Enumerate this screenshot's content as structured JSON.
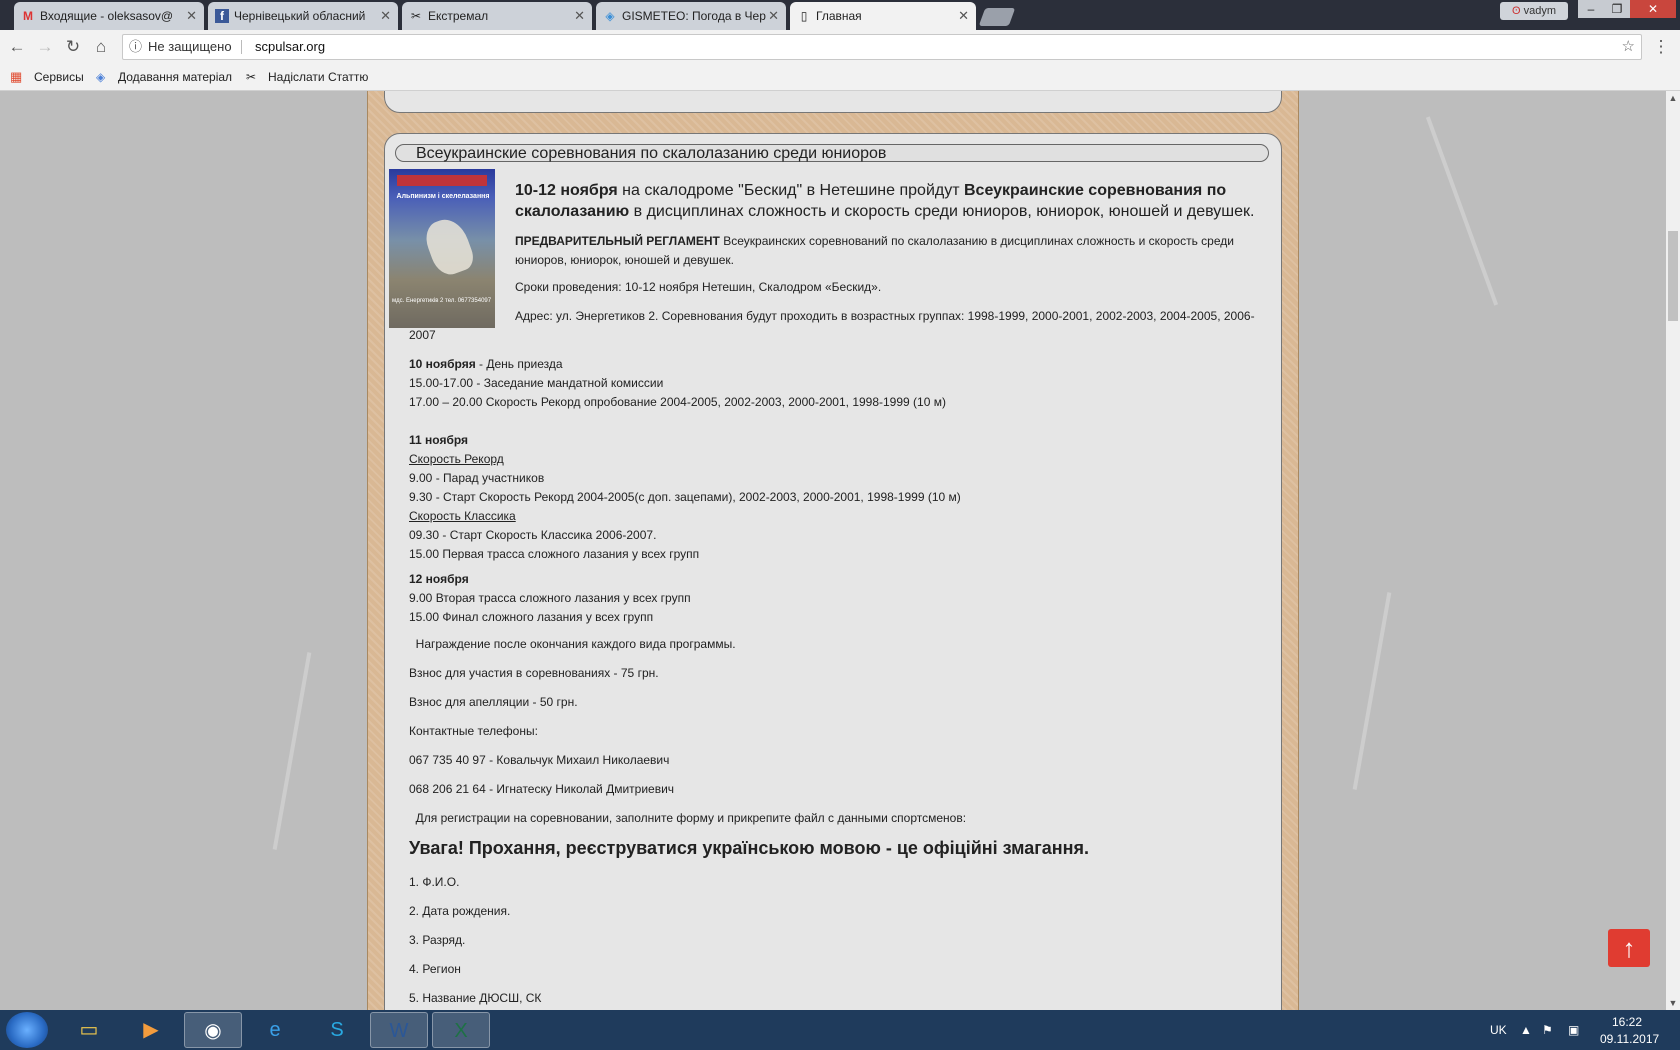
{
  "browser": {
    "tabs": [
      {
        "label": "Входящие - oleksasov@",
        "icon": "M"
      },
      {
        "label": "Чернівецький обласний",
        "icon": "f"
      },
      {
        "label": "Екстремал",
        "icon": "✂"
      },
      {
        "label": "GISMETEO: Погода в Чер",
        "icon": "◈"
      },
      {
        "label": "Главная",
        "icon": "▯"
      }
    ],
    "user": "vadym",
    "security": "Не защищено",
    "url": "scpulsar.org",
    "bookmarks": [
      "Сервисы",
      "Додавання матеріал",
      "Надіслати Статтю"
    ]
  },
  "article": {
    "title": "Всеукраинские соревнования по скалолазанию среди юниоров",
    "poster": {
      "caption": "Альпинизм і скелелазання",
      "info": "мдс. Енергетиків 2 тел. 0677354097"
    },
    "lead": {
      "date": "10-12 ноября",
      "mid": " на скалодроме \"Бескид\" в Нетешине пройдут ",
      "bold": "Всеукраинские соревнования по скалолазанию",
      "tail": "  в дисциплинах сложность и скорость среди юниоров, юниорок, юношей и девушек."
    },
    "reglament_bold": " ПРЕДВАРИТЕЛЬНЫЙ РЕГЛАМЕНТ",
    "reglament_text": " Всеукраинских соревнований по скалолазанию в дисциплинах сложность и скорость среди",
    "reglament_text2": "юниоров, юниорок, юношей и девушек.",
    "terms": "Сроки проведения: 10-12 ноября Нетешин, Скалодром «Бескид».",
    "address": "Адрес: ул. Энергетиков 2. Соревнования будут проходить в возрастных группах: 1998-1999, 2000-2001, 2002-2003, 2004-2005, 2006-",
    "address2": "2007",
    "day10_head": "10 ноябряя",
    "day10_tail": " - День приезда",
    "day10_lines": [
      "15.00-17.00 - Заседание мандатной комиссии",
      "17.00 – 20.00 Скорость Рекорд опробование 2004-2005, 2002-2003, 2000-2001, 1998-1999 (10 м)"
    ],
    "day11_head": "11 ноября",
    "speed_record_link": "Скорость Рекорд",
    "day11_lines_a": [
      "9.00 - Парад участников",
      "9.30 - Старт Скорость Рекорд 2004-2005(с доп. зацепами), 2002-2003, 2000-2001, 1998-1999 (10 м)"
    ],
    "speed_classic_link": "Скорость Классика",
    "day11_lines_b": [
      "09.30 - Старт Скорость Классика 2006-2007.",
      "15.00  Первая трасса сложного лазания у всех групп"
    ],
    "day12_head": "12 ноября",
    "day12_lines": [
      "9.00  Вторая трасса сложного лазания у всех групп",
      "15.00 Финал сложного лазания у всех групп"
    ],
    "award": "  Награждение после окончания каждого вида программы.",
    "fee": "Взнос для участия в соревнованиях - 75 грн.",
    "appeal_fee": "Взнос для апелляции - 50 грн.",
    "contacts_label": "Контактные телефоны:",
    "contact1": "067 735 40 97 - Ковальчук Михаил Николаевич",
    "contact2": "068 206 21 64 - Игнатеску Николай Дмитриевич",
    "registration": "  Для регистрации на соревновании, заполните форму и прикрепите файл с данными спортсменов:",
    "warning": "Увага! Прохання, реєструватися українською мовою - це офіційні змагання.",
    "form_items": [
      "1. Ф.И.О.",
      "2. Дата рождения.",
      "3. Разряд.",
      "4. Регион",
      "5. Название ДЮСШ, СК"
    ]
  },
  "taskbar": {
    "lang": "UK",
    "time": "16:22",
    "date": "09.11.2017"
  }
}
